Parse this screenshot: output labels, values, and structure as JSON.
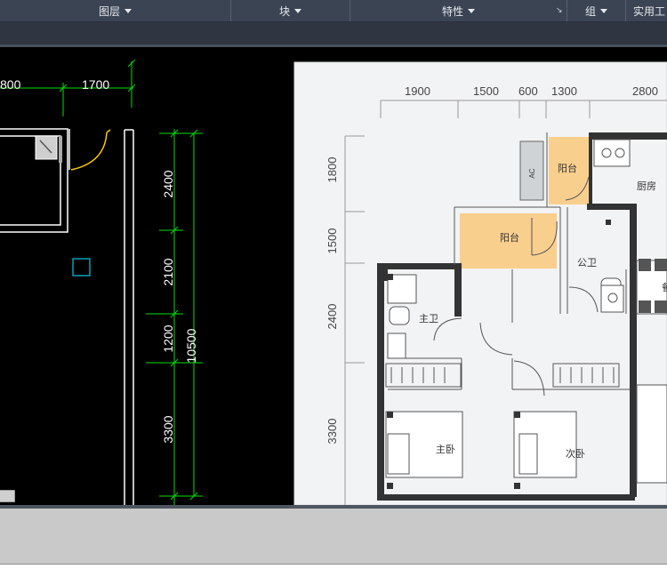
{
  "ribbon": {
    "panels": [
      {
        "label": "图层"
      },
      {
        "label": "块"
      },
      {
        "label": "特性"
      },
      {
        "label": "组"
      },
      {
        "label": "实用工"
      }
    ]
  },
  "cad_drawing": {
    "top_dims": [
      "800",
      "1700"
    ],
    "side_dims": [
      "2400",
      "2100",
      "1200",
      "3300"
    ],
    "overall_dim": "10500"
  },
  "floor_plan": {
    "top_dims": [
      "1900",
      "1500",
      "600",
      "1300",
      "2800"
    ],
    "side_dims": [
      "1800",
      "1500",
      "2400",
      "3300"
    ],
    "rooms": {
      "balcony_small": "阳台",
      "balcony_large": "阳台",
      "kitchen": "厨房",
      "public_bath": "公卫",
      "master_bath": "主卫",
      "master_bed": "主卧",
      "second_bed": "次卧",
      "partial": "餐"
    },
    "ac_label": "AC"
  },
  "colors": {
    "ribbon_bg": "#3b4453",
    "cad_bg": "#000000",
    "dim_green": "#00e000",
    "wall_white": "#ffffff",
    "cyan_marker": "#00c8e8",
    "plan_bg": "#f2f3f4",
    "balcony_fill": "#f9cf8e",
    "plan_wall": "#333333",
    "panel_gray": "#c9c9c9"
  }
}
